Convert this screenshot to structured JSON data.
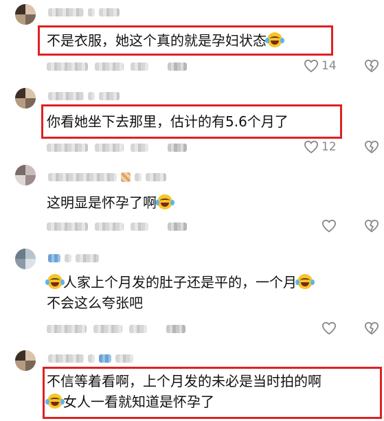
{
  "comments": [
    {
      "text_lines": [
        "不是衣服，她这个真的就是孕妇状态"
      ],
      "trailing_emoji": "tears-of-joy-emoji",
      "like_count": "14",
      "highlighted": true
    },
    {
      "text_lines": [
        "你看她坐下去那里，估计的有5.6个月了"
      ],
      "like_count": "12",
      "highlighted": true
    },
    {
      "text_lines": [
        "这明显是怀孕了啊"
      ],
      "trailing_emoji": "tears-of-joy-emoji",
      "like_count": "",
      "highlighted": false
    },
    {
      "text_lines": [
        "人家上个月发的肚子还是平的，一个月",
        "不会这么夸张吧"
      ],
      "leading_emoji": "tears-of-joy-emoji",
      "like_count": "",
      "highlighted": false
    },
    {
      "text_lines": [
        "不信等着看啊，上个月发的未必是当时拍的啊",
        "女人一看就知道是怀孕了"
      ],
      "line2_leading_emoji": "tears-of-joy-emoji",
      "like_count": "",
      "highlighted": true
    }
  ],
  "colors": {
    "highlight": "#e02020",
    "text": "#111111",
    "meta": "#888888"
  }
}
